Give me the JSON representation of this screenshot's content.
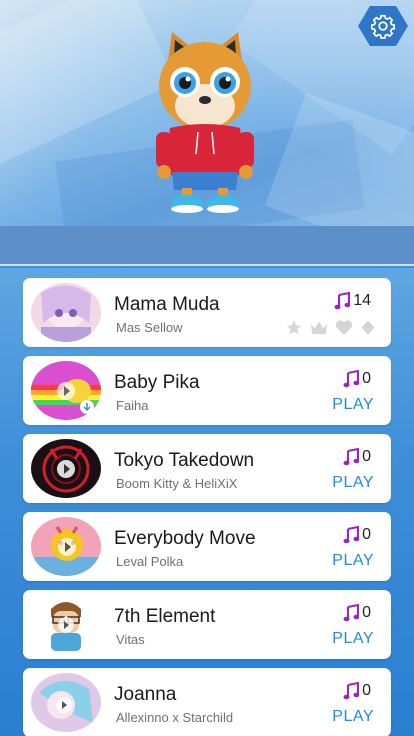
{
  "header": {
    "settings_icon": "gear-icon",
    "character": "shiba-dog-character"
  },
  "songs": [
    {
      "title": "Mama Muda",
      "artist": "Mas Sellow",
      "notes": "14",
      "state": "rated",
      "thumb_colors": [
        "#f3d8e8",
        "#b9a0d8"
      ]
    },
    {
      "title": "Baby Pika",
      "artist": "Faiha",
      "notes": "0",
      "state": "play",
      "action": "PLAY",
      "thumb_colors": [
        "#d94fd0",
        "#f5d33a"
      ]
    },
    {
      "title": "Tokyo Takedown",
      "artist": "Boom Kitty & HeliXiX",
      "notes": "0",
      "state": "play",
      "action": "PLAY",
      "thumb_colors": [
        "#1a0f14",
        "#d0202b"
      ]
    },
    {
      "title": "Everybody Move",
      "artist": "Leval Polka",
      "notes": "0",
      "state": "play",
      "action": "PLAY",
      "thumb_colors": [
        "#f5c521",
        "#e24a7a"
      ]
    },
    {
      "title": "7th Element",
      "artist": "Vitas",
      "notes": "0",
      "state": "play",
      "action": "PLAY",
      "thumb_colors": [
        "#ffffff",
        "#4aa7d8"
      ]
    },
    {
      "title": "Joanna",
      "artist": "Allexinno x Starchild",
      "notes": "0",
      "state": "play",
      "action": "PLAY",
      "thumb_colors": [
        "#e0c9e8",
        "#8ad0e8"
      ]
    }
  ],
  "colors": {
    "accent_play": "#1f8be6",
    "note_icon": "#a01fc9",
    "rating_icons": "#d5d5d5"
  }
}
